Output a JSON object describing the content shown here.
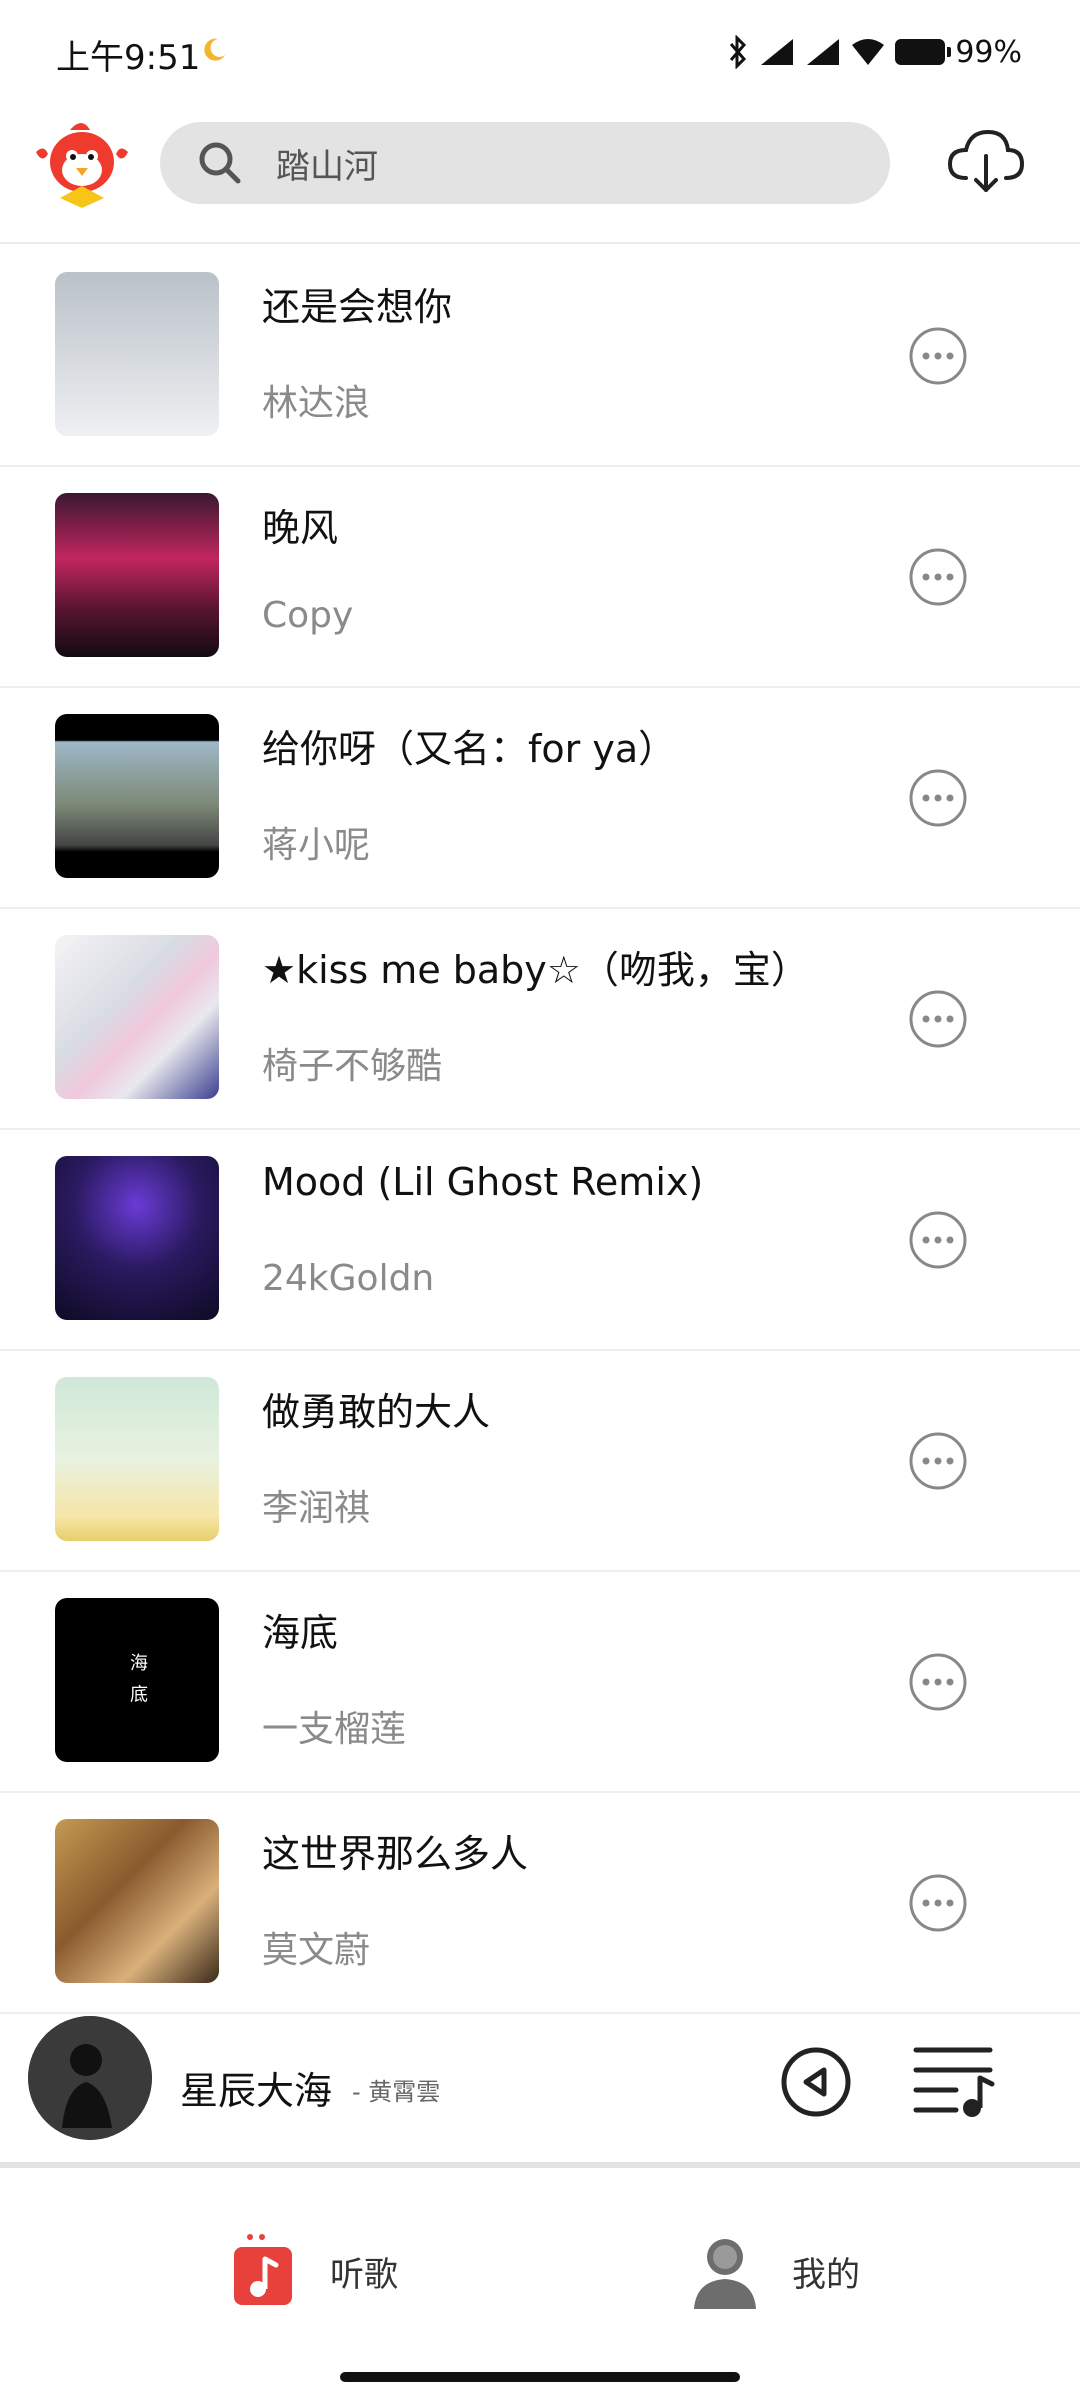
{
  "status_bar": {
    "time": "上午9:51",
    "battery": "99%"
  },
  "search": {
    "placeholder": "踏山河"
  },
  "songs": [
    {
      "title": "还是会想你",
      "artist": "林达浪"
    },
    {
      "title": "晚风",
      "artist": "Copy"
    },
    {
      "title": "给你呀（又名：for ya）",
      "artist": "蒋小呢"
    },
    {
      "title": "★kiss me baby☆（吻我，宝）",
      "artist": "椅子不够酷"
    },
    {
      "title": "Mood (Lil Ghost Remix)",
      "artist": "24kGoldn"
    },
    {
      "title": "做勇敢的大人",
      "artist": "李润祺"
    },
    {
      "title": "海底",
      "artist": "一支榴莲",
      "cover_text": "海 底"
    },
    {
      "title": "这世界那么多人",
      "artist": "莫文蔚"
    }
  ],
  "player": {
    "title": "星辰大海",
    "artist": "- 黄霄雲"
  },
  "nav": {
    "listen": "听歌",
    "mine": "我的"
  },
  "colors": {
    "accent": "#e8403a",
    "search_bg": "#e3e3e3"
  }
}
